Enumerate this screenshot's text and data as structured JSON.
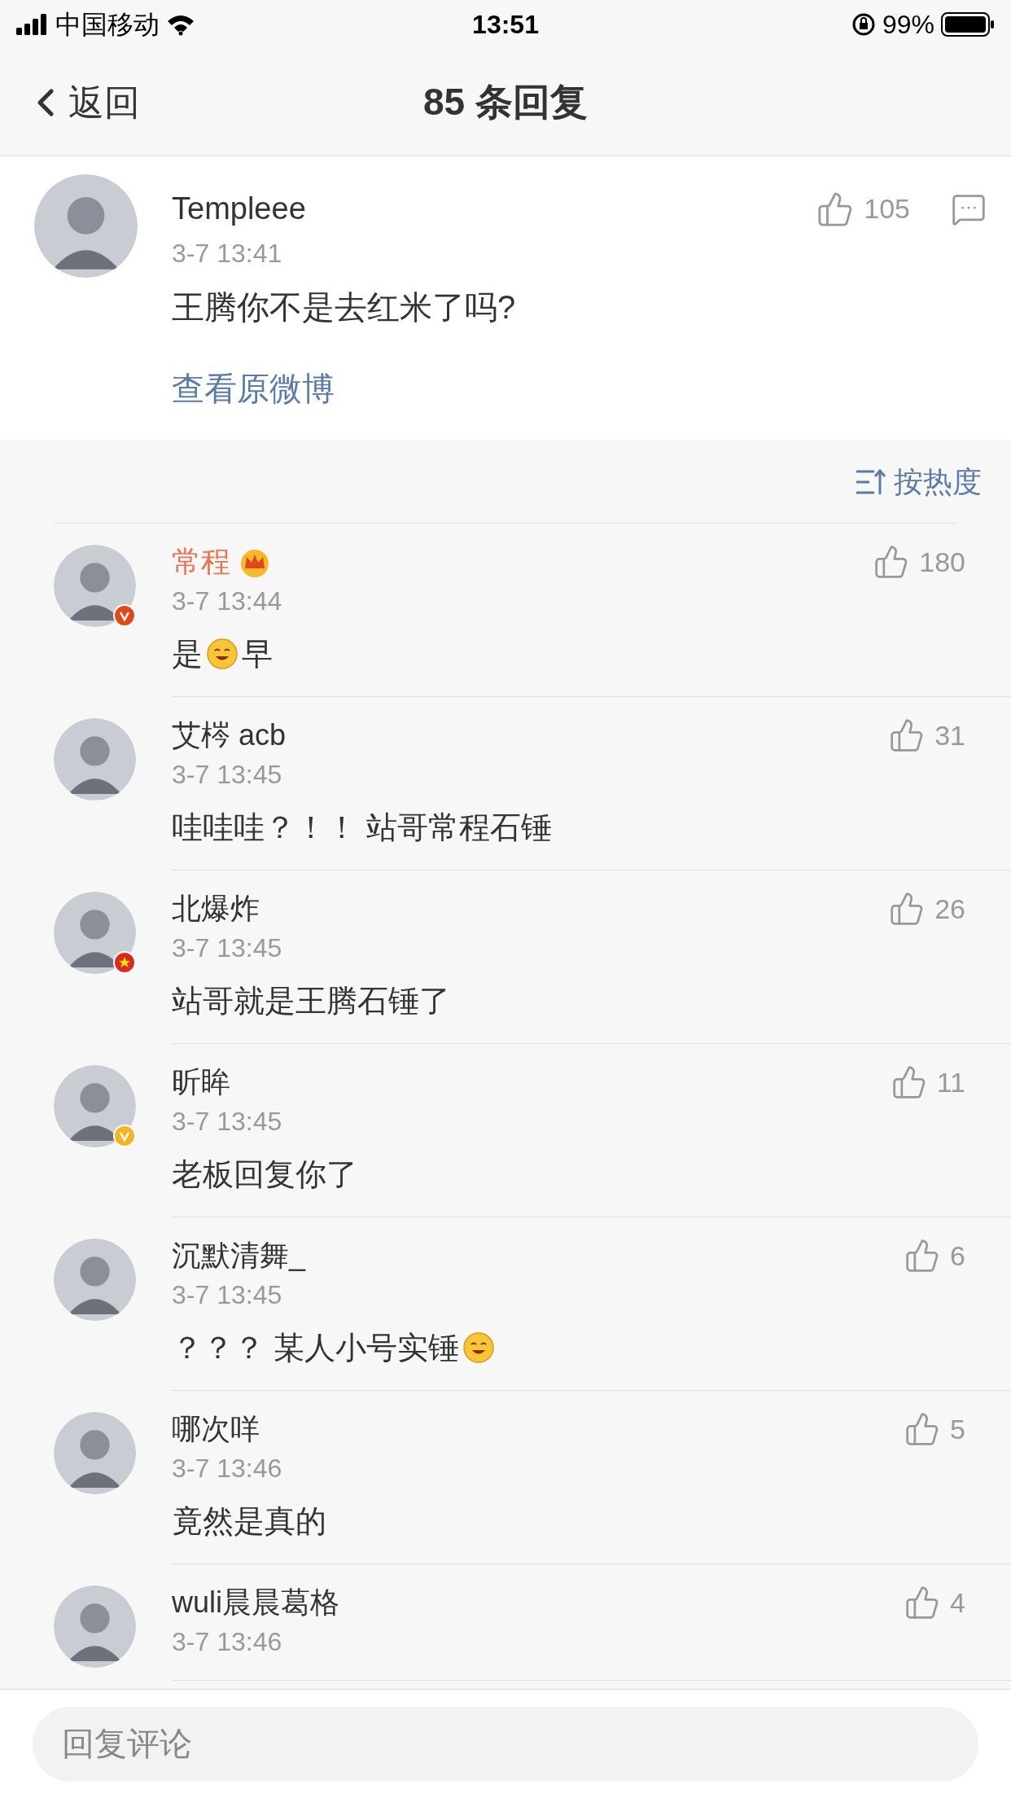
{
  "status_bar": {
    "carrier": "中国移动",
    "time": "13:51",
    "battery": "99%"
  },
  "nav": {
    "back": "返回",
    "title": "85 条回复"
  },
  "main_comment": {
    "user": "Templeee",
    "time": "3-7 13:41",
    "text": "王腾你不是去红米了吗?",
    "likes": "105",
    "link": "查看原微博"
  },
  "sort": {
    "label": "按热度"
  },
  "replies": [
    {
      "user": "常程",
      "vip": true,
      "badge": {
        "kind": "verified",
        "color": "#e2461b"
      },
      "time": "3-7 13:44",
      "parts": [
        {
          "kind": "text",
          "text": "是"
        },
        {
          "kind": "emoji"
        },
        {
          "kind": "text",
          "text": "早"
        }
      ],
      "likes": "180"
    },
    {
      "user": "艾梣 acb",
      "vip": false,
      "time": "3-7 13:45",
      "parts": [
        {
          "kind": "text",
          "text": "哇哇哇？！！ 站哥常程石锤"
        }
      ],
      "likes": "31"
    },
    {
      "user": "北爆炸",
      "vip": false,
      "badge": {
        "kind": "flag",
        "color": "#d92a1f"
      },
      "time": "3-7 13:45",
      "parts": [
        {
          "kind": "text",
          "text": "站哥就是王腾石锤了"
        }
      ],
      "likes": "26"
    },
    {
      "user": "昕眸",
      "vip": false,
      "badge": {
        "kind": "verified",
        "color": "#f5b523"
      },
      "time": "3-7 13:45",
      "parts": [
        {
          "kind": "text",
          "text": "老板回复你了"
        }
      ],
      "likes": "11"
    },
    {
      "user": "沉默清舞_",
      "vip": false,
      "time": "3-7 13:45",
      "parts": [
        {
          "kind": "text",
          "text": "？？？ 某人小号实锤"
        },
        {
          "kind": "emoji"
        }
      ],
      "likes": "6"
    },
    {
      "user": "哪次咩",
      "vip": false,
      "time": "3-7 13:46",
      "parts": [
        {
          "kind": "text",
          "text": "竟然是真的"
        }
      ],
      "likes": "5"
    },
    {
      "user": "wuli晨晨葛格",
      "vip": false,
      "time": "3-7 13:46",
      "likes": "4"
    }
  ],
  "reply_bar": {
    "placeholder": "回复评论"
  }
}
